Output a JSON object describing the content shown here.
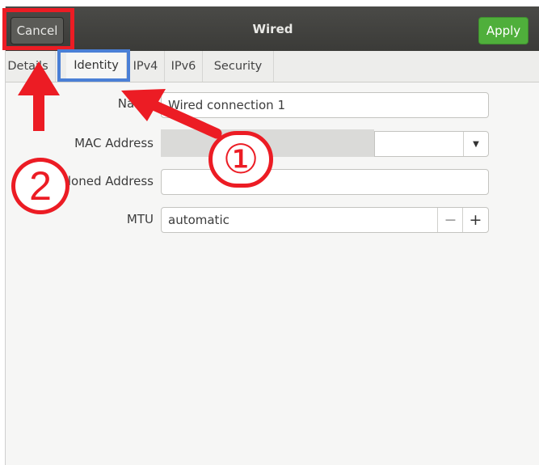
{
  "header": {
    "cancel_label": "Cancel",
    "title": "Wired",
    "apply_label": "Apply"
  },
  "tabs": [
    {
      "label": "Details"
    },
    {
      "label": "Identity",
      "active": true
    },
    {
      "label": "IPv4"
    },
    {
      "label": "IPv6"
    },
    {
      "label": "Security"
    }
  ],
  "form": {
    "name_label": "Name",
    "name_value": "Wired connection 1",
    "mac_label": "MAC Address",
    "mac_value": "",
    "cloned_label": "Cloned Address",
    "cloned_value": "",
    "mtu_label": "MTU",
    "mtu_value": "automatic",
    "mtu_minus": "−",
    "mtu_plus": "+"
  },
  "annotations": {
    "step1": "①",
    "step2": "2",
    "highlight_red": "#ec1c24",
    "highlight_blue": "#4a7fd6"
  }
}
